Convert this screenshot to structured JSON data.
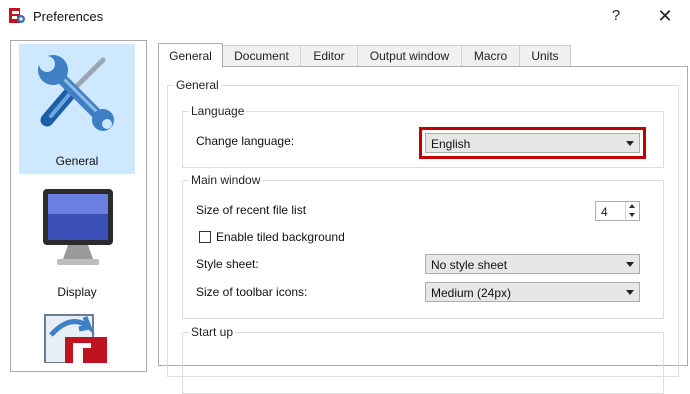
{
  "window": {
    "title": "Preferences",
    "help_label": "?",
    "close_label": "✕"
  },
  "sidebar": {
    "items": [
      {
        "label": "General",
        "icon": "tools-icon",
        "selected": true
      },
      {
        "label": "Display",
        "icon": "monitor-icon",
        "selected": false
      },
      {
        "label": "",
        "icon": "import-export-icon",
        "selected": false
      }
    ]
  },
  "tabs": [
    {
      "label": "General",
      "active": true
    },
    {
      "label": "Document",
      "active": false
    },
    {
      "label": "Editor",
      "active": false
    },
    {
      "label": "Output window",
      "active": false
    },
    {
      "label": "Macro",
      "active": false
    },
    {
      "label": "Units",
      "active": false
    }
  ],
  "general": {
    "group_title": "General",
    "language": {
      "title": "Language",
      "change_label": "Change language:",
      "value": "English"
    },
    "main_window": {
      "title": "Main window",
      "recent_files_label": "Size of recent file list",
      "recent_files_value": "4",
      "tiled_bg_label": "Enable tiled background",
      "tiled_bg_checked": false,
      "style_sheet_label": "Style sheet:",
      "style_sheet_value": "No style sheet",
      "toolbar_icons_label": "Size of toolbar icons:",
      "toolbar_icons_value": "Medium (24px)"
    },
    "startup": {
      "title": "Start up"
    }
  },
  "colors": {
    "highlight": "#c00000",
    "selection": "#cde8ff"
  }
}
